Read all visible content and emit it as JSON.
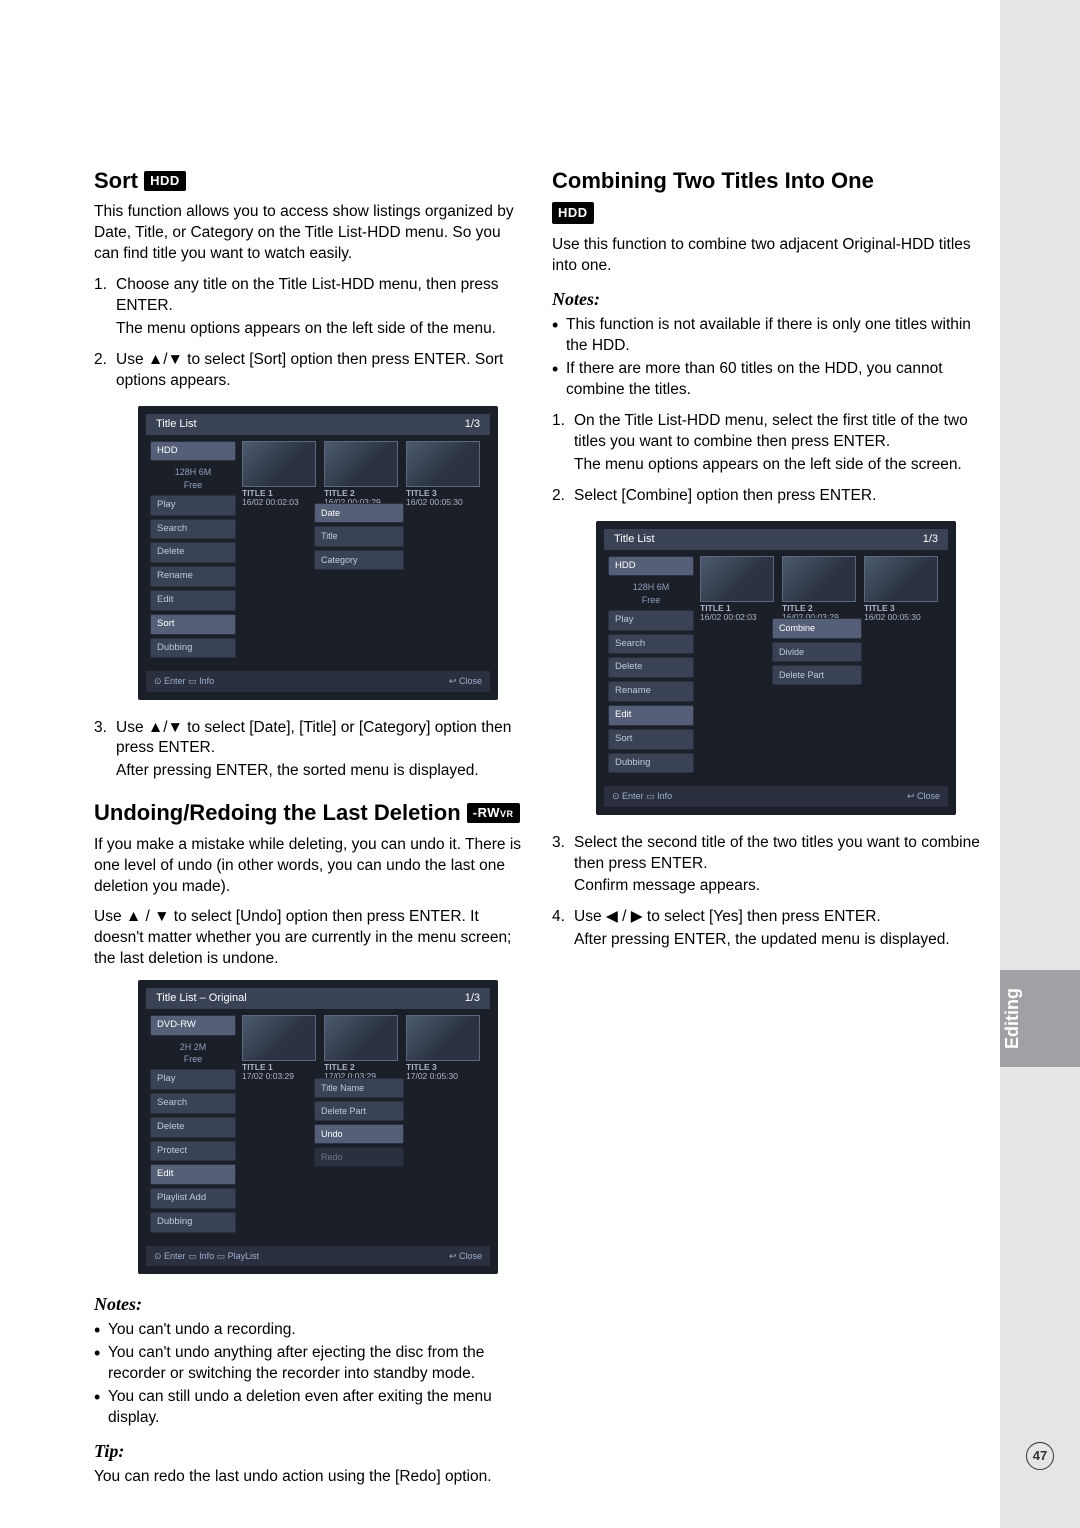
{
  "sidebar": {
    "tab": "Editing"
  },
  "page_number": "47",
  "left": {
    "sort": {
      "title": "Sort",
      "badge": "HDD",
      "intro": "This function allows you to access show listings organized by Date, Title, or Category on the Title List-HDD menu. So you can find title you want to watch easily.",
      "step1_a": "Choose any title on the Title List-HDD menu, then press ENTER.",
      "step1_b": "The menu options appears on the left side of the menu.",
      "step2": "Use ▲/▼ to select [Sort] option then press ENTER. Sort options appears.",
      "step3_a": "Use ▲/▼ to select [Date], [Title] or [Category] option then press ENTER.",
      "step3_b": "After pressing ENTER, the sorted menu is displayed."
    },
    "sc1": {
      "header": "Title List",
      "page": "1/3",
      "disk": "HDD",
      "free": "128H 6M",
      "free_l": "Free",
      "m_play": "Play",
      "m_search": "Search",
      "m_delete": "Delete",
      "m_rename": "Rename",
      "m_edit": "Edit",
      "m_sort": "Sort",
      "m_dub": "Dubbing",
      "s_date": "Date",
      "s_title": "Title",
      "s_category": "Category",
      "t1_t": "TITLE 1",
      "t1_s": "16/02   00:02:03",
      "t2_t": "TITLE 2",
      "t2_s": "16/02   00:03:29",
      "t3_t": "TITLE 3",
      "t3_s": "16/02   00:05:30",
      "f_enter": "Enter",
      "f_info": "Info",
      "f_close": "Close"
    },
    "undo": {
      "title": "Undoing/Redoing the Last Deletion",
      "badge": "-RW",
      "badge_sub": "VR",
      "p1": "If you make a mistake while deleting, you can undo it. There is one level of undo (in other words, you can undo the last one deletion you made).",
      "p2": "Use ▲ / ▼ to select [Undo] option then press ENTER. It doesn't matter whether you are currently in the menu screen; the last deletion is undone.",
      "notes_h": "Notes:",
      "n1": "You can't undo a recording.",
      "n2": "You can't undo anything after ejecting the disc from the recorder or switching the recorder into standby mode.",
      "n3": "You can still undo a deletion even after exiting the menu display.",
      "tip_h": "Tip:",
      "tip": "You can redo the last undo action using the [Redo] option."
    },
    "sc2": {
      "header": "Title List  – Original",
      "page": "1/3",
      "disk": "DVD-RW",
      "free": "2H 2M",
      "free_l": "Free",
      "m_play": "Play",
      "m_search": "Search",
      "m_delete": "Delete",
      "m_protect": "Protect",
      "m_edit": "Edit",
      "m_pladd": "Playlist Add",
      "m_dub": "Dubbing",
      "s_tname": "Title Name",
      "s_dpart": "Delete Part",
      "s_undo": "Undo",
      "s_redo": "Redo",
      "t1_t": "TITLE 1",
      "t1_s": "17/02   0:03:29",
      "t2_t": "TITLE 2",
      "t2_s": "17/02   0:03:29",
      "t3_t": "TITLE 3",
      "t3_s": "17/02   0:05:30",
      "f_enter": "Enter",
      "f_info": "Info",
      "f_pl": "PlayList",
      "f_close": "Close"
    }
  },
  "right": {
    "combine": {
      "title": "Combining Two Titles Into One",
      "badge": "HDD",
      "intro": "Use this function to combine two adjacent Original-HDD titles into one.",
      "notes_h": "Notes:",
      "n1": "This function is not available if there is only one titles within the HDD.",
      "n2": "If there are more than 60 titles on the HDD, you cannot combine the titles.",
      "step1_a": "On the Title List-HDD menu, select the first title of the two titles you want to combine then press ENTER.",
      "step1_b": "The menu options appears on the left side of the screen.",
      "step2": "Select [Combine] option then press ENTER.",
      "step3_a": "Select the second title of the two titles you want to combine then press ENTER.",
      "step3_b": "Confirm message appears.",
      "step4_a": "Use ◀ / ▶ to select [Yes] then press ENTER.",
      "step4_b": "After pressing ENTER, the updated menu is displayed."
    },
    "sc3": {
      "header": "Title List",
      "page": "1/3",
      "disk": "HDD",
      "free": "128H 6M",
      "free_l": "Free",
      "m_play": "Play",
      "m_search": "Search",
      "m_delete": "Delete",
      "m_rename": "Rename",
      "m_edit": "Edit",
      "m_sort": "Sort",
      "m_dub": "Dubbing",
      "s_combine": "Combine",
      "s_divide": "Divide",
      "s_dpart": "Delete Part",
      "t1_t": "TITLE 1",
      "t1_s": "16/02   00:02:03",
      "t2_t": "TITLE 2",
      "t2_s": "16/02   00:03:29",
      "t3_t": "TITLE 3",
      "t3_s": "16/02   00:05:30",
      "f_enter": "Enter",
      "f_info": "Info",
      "f_close": "Close"
    }
  }
}
